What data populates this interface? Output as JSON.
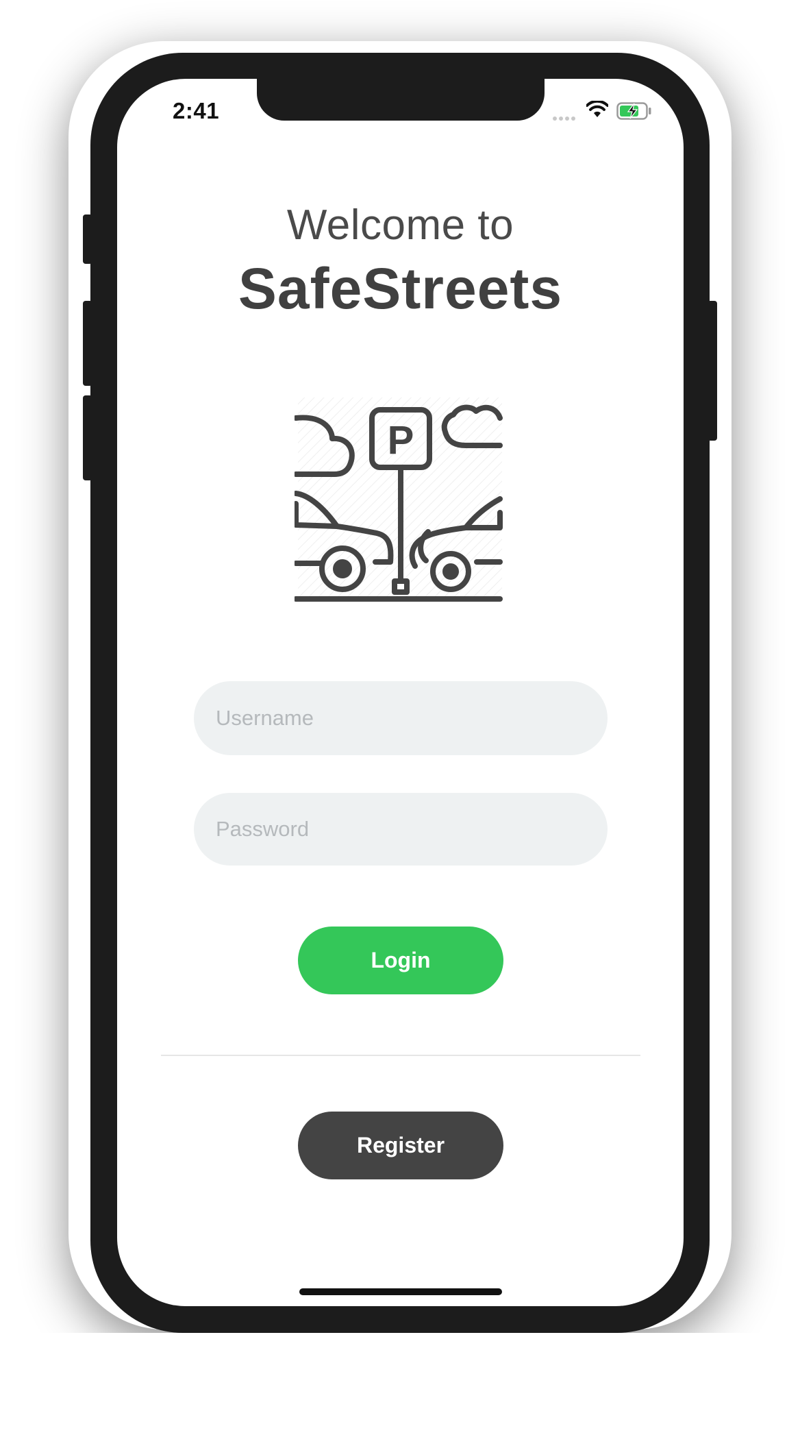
{
  "status_bar": {
    "time": "2:41",
    "wifi_icon": "wifi-icon",
    "battery_icon": "battery-charging-icon",
    "signal_icon": "signal-dots-icon"
  },
  "header": {
    "welcome": "Welcome to",
    "app_name": "SafeStreets"
  },
  "illustration": {
    "icon": "parking-lot-icon",
    "sign_letter": "P"
  },
  "form": {
    "username_placeholder": "Username",
    "password_placeholder": "Password",
    "login_label": "Login",
    "register_label": "Register"
  },
  "colors": {
    "login": "#34c759",
    "register": "#444444",
    "input_bg": "#eef1f2",
    "text": "#404040"
  }
}
